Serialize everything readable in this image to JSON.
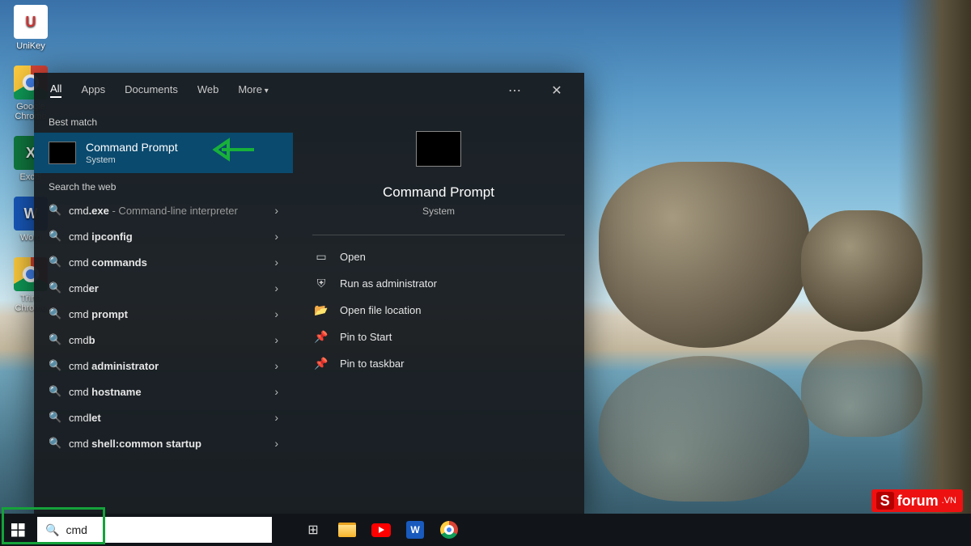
{
  "desktop_icons": [
    {
      "name": "unikey-shortcut",
      "label": "UniKey",
      "glyph": "U",
      "cls": "b-unikey"
    },
    {
      "name": "chrome-shortcut",
      "label": "Google Chrome",
      "glyph": "",
      "cls": "b-chrome"
    },
    {
      "name": "excel-shortcut",
      "label": "Excel",
      "glyph": "X",
      "cls": "b-excel"
    },
    {
      "name": "word-shortcut",
      "label": "Word",
      "glyph": "W",
      "cls": "b-word"
    },
    {
      "name": "chrome-shortcut-2",
      "label": "Trình Chrome",
      "glyph": "",
      "cls": "b-chrome"
    }
  ],
  "search": {
    "tabs": {
      "all": "All",
      "apps": "Apps",
      "docs": "Documents",
      "web": "Web",
      "more": "More"
    },
    "best_match_label": "Best match",
    "best_match": {
      "title": "Command Prompt",
      "subtitle": "System"
    },
    "web_label": "Search the web",
    "web_results": [
      {
        "pre": "cmd",
        "bold": ".exe",
        "suffix": " - Command-line interpreter"
      },
      {
        "pre": "cmd ",
        "bold": "ipconfig",
        "suffix": ""
      },
      {
        "pre": "cmd ",
        "bold": "commands",
        "suffix": ""
      },
      {
        "pre": "cmd",
        "bold": "er",
        "suffix": ""
      },
      {
        "pre": "cmd ",
        "bold": "prompt",
        "suffix": ""
      },
      {
        "pre": "cmd",
        "bold": "b",
        "suffix": ""
      },
      {
        "pre": "cmd ",
        "bold": "administrator",
        "suffix": ""
      },
      {
        "pre": "cmd ",
        "bold": "hostname",
        "suffix": ""
      },
      {
        "pre": "cmd",
        "bold": "let",
        "suffix": ""
      },
      {
        "pre": "cmd ",
        "bold": "shell:common startup",
        "suffix": ""
      }
    ],
    "detail": {
      "title": "Command Prompt",
      "subtitle": "System",
      "actions": [
        {
          "name": "action-open",
          "icon": "▭",
          "label": "Open"
        },
        {
          "name": "action-run-admin",
          "icon": "⛨",
          "label": "Run as administrator"
        },
        {
          "name": "action-open-location",
          "icon": "📂",
          "label": "Open file location"
        },
        {
          "name": "action-pin-start",
          "icon": "📌",
          "label": "Pin to Start"
        },
        {
          "name": "action-pin-taskbar",
          "icon": "📌",
          "label": "Pin to taskbar"
        }
      ]
    },
    "input_value": "cmd"
  },
  "watermark": {
    "brand": "forum",
    "suffix": ".VN",
    "badge": "S"
  }
}
